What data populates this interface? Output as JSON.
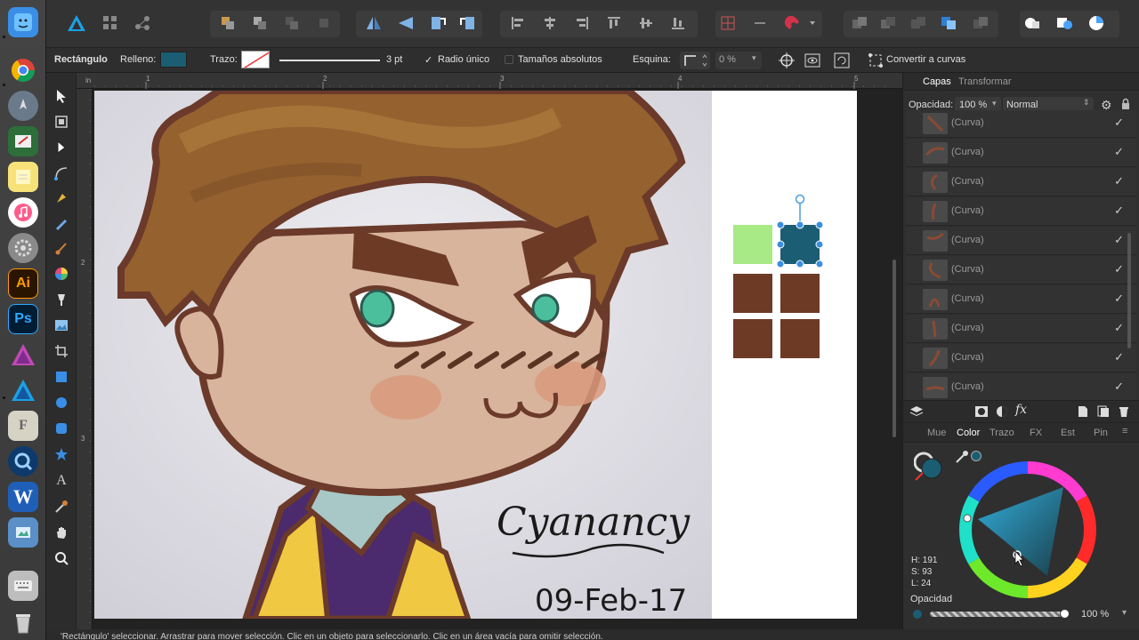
{
  "context_bar": {
    "shape_label": "Rectángulo",
    "fill_label": "Relleno:",
    "fill_color": "#1b5d72",
    "stroke_label": "Trazo:",
    "stroke_width": "3 pt",
    "single_radius_label": "Radio único",
    "absolute_sizes_label": "Tamaños absolutos",
    "corner_label": "Esquina:",
    "corner_value": "0 %",
    "convert_label": "Convertir a curvas"
  },
  "rulers": {
    "unit": "in",
    "top_ticks": [
      "1",
      "2",
      "3",
      "4",
      "5"
    ],
    "left_ticks": [
      "2",
      "3"
    ]
  },
  "artwork": {
    "signature": "Cyanancy",
    "date": "09-Feb-17"
  },
  "swatches": {
    "green": "#a8ea86",
    "teal": "#1b5d72",
    "brown": "#6d3a25"
  },
  "layers_panel": {
    "tabs": [
      "Capas",
      "Transformar"
    ],
    "opacity_label": "Opacidad:",
    "opacity_value": "100 %",
    "blend_mode": "Normal",
    "layers": [
      {
        "name": "(Curva)"
      },
      {
        "name": "(Curva)"
      },
      {
        "name": "(Curva)"
      },
      {
        "name": "(Curva)"
      },
      {
        "name": "(Curva)"
      },
      {
        "name": "(Curva)"
      },
      {
        "name": "(Curva)"
      },
      {
        "name": "(Curva)"
      },
      {
        "name": "(Curva)"
      },
      {
        "name": "(Curva)"
      }
    ]
  },
  "color_panel": {
    "tabs": [
      "Mue",
      "Color",
      "Trazo",
      "FX",
      "Est",
      "Pin"
    ],
    "active_tab": "Color",
    "h_readout": "H: 191",
    "s_readout": "S: 93",
    "l_readout": "L: 24",
    "opacity_label": "Opacidad",
    "opacity_value": "100 %"
  },
  "status_bar": {
    "text": "'Rectángulo' seleccionar. Arrastrar para mover selección. Clic en un objeto para seleccionarlo. Clic en un área vacía para omitir selección."
  },
  "dock": {
    "ai_label": "Ai",
    "ps_label": "Ps"
  }
}
